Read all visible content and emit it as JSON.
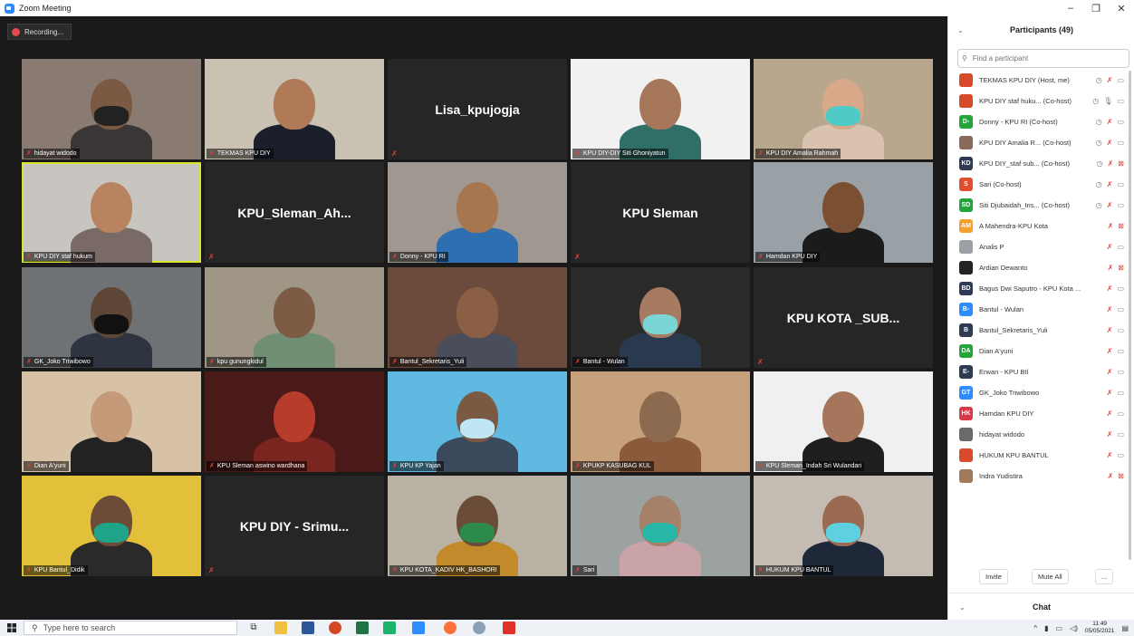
{
  "window": {
    "title": "Zoom Meeting"
  },
  "recording": {
    "label": "Recording..."
  },
  "tiles": [
    {
      "name": "hidayat widodo",
      "type": "video",
      "bg": "#8a7b72",
      "skin": "#7b5a44",
      "shirt": "#3a3636",
      "mask": "#222222"
    },
    {
      "name": "TEKMAS KPU DIY",
      "type": "video",
      "bg": "#c9c2b3",
      "skin": "#b07a58",
      "shirt": "#1b1f2b",
      "mask": ""
    },
    {
      "name": "",
      "type": "name",
      "display": "Lisa_kpujogja"
    },
    {
      "name": "KPU DIY-DIY Siti Ghoniyatun",
      "type": "video",
      "bg": "#f1f1f1",
      "skin": "#a7775b",
      "shirt": "#2f6f68",
      "mask": ""
    },
    {
      "name": "KPU DIY Amalia Rahmah",
      "type": "video",
      "bg": "#b9a78d",
      "skin": "#d8a889",
      "shirt": "#d9c3b0",
      "mask": "#4fcac6"
    },
    {
      "name": "KPU DIY staf hukum",
      "type": "video",
      "bg": "#c8c5c0",
      "skin": "#b8835f",
      "shirt": "#7a6a66",
      "mask": "",
      "active": true
    },
    {
      "name": "",
      "type": "name",
      "display": "KPU_Sleman_Ah..."
    },
    {
      "name": "Donny - KPU RI",
      "type": "video",
      "bg": "#a09890",
      "skin": "#a7764e",
      "shirt": "#2d6fb0",
      "mask": ""
    },
    {
      "name": "",
      "type": "name",
      "display": "KPU Sleman"
    },
    {
      "name": "Hamdan KPU DIY",
      "type": "video",
      "bg": "#9aa1a6",
      "skin": "#7a4f32",
      "shirt": "#1b1b1b",
      "mask": ""
    },
    {
      "name": "GK_Joko Triwibowo",
      "type": "video",
      "bg": "#6f7275",
      "skin": "#5e4636",
      "shirt": "#2f3540",
      "mask": "#111111"
    },
    {
      "name": "kpu gunungkidul",
      "type": "video",
      "bg": "#9f9686",
      "skin": "#7d5b44",
      "shirt": "#6f8e73",
      "mask": ""
    },
    {
      "name": "Bantul_Sekretaris_Yuli",
      "type": "video",
      "bg": "#6d4b3c",
      "skin": "#8b5f43",
      "shirt": "#4a4e5a",
      "mask": ""
    },
    {
      "name": "Bantul - Wulan",
      "type": "video",
      "bg": "#2a2a2a",
      "skin": "#a77b62",
      "shirt": "#2a3a4e",
      "mask": "#7ad6d5"
    },
    {
      "name": "",
      "type": "name",
      "display": "KPU KOTA _SUB..."
    },
    {
      "name": "Dian A'yuni",
      "type": "video",
      "bg": "#d8c2a6",
      "skin": "#c49a78",
      "shirt": "#222222",
      "mask": ""
    },
    {
      "name": "KPU Sleman aswino wardhana",
      "type": "video",
      "bg": "#4a1a18",
      "skin": "#b83c2c",
      "shirt": "#7a2520",
      "mask": ""
    },
    {
      "name": "KPU KP Yajan",
      "type": "video",
      "bg": "#5fb9e0",
      "skin": "#7b5a44",
      "shirt": "#3a4a5c",
      "mask": "#bfe6f3"
    },
    {
      "name": "KPUKP KASUBAG KUL",
      "type": "video",
      "bg": "#c7a17c",
      "skin": "#8b6a50",
      "shirt": "#8b5a3a",
      "mask": ""
    },
    {
      "name": "KPU Sleman_Indah Sri Wulandari",
      "type": "video",
      "bg": "#f0f0f0",
      "skin": "#a5765c",
      "shirt": "#1f1f1f",
      "mask": ""
    },
    {
      "name": "KPU Bantul_Didik",
      "type": "video",
      "bg": "#e3c03a",
      "skin": "#6c4b38",
      "shirt": "#2a2a2a",
      "mask": "#1fa48a"
    },
    {
      "name": "",
      "type": "name",
      "display": "KPU DIY - Srimu..."
    },
    {
      "name": "KPU KOTA_KADIV HK_BASHORI",
      "type": "video",
      "bg": "#b9b2a4",
      "skin": "#6b4c38",
      "shirt": "#c28a2a",
      "mask": "#2c8a4a"
    },
    {
      "name": "Sari",
      "type": "video",
      "bg": "#9ca2a0",
      "skin": "#a68068",
      "shirt": "#c9a3a8",
      "mask": "#28b6a6"
    },
    {
      "name": "HUKUM KPU BANTUL",
      "type": "video",
      "bg": "#c4bcb3",
      "skin": "#9a6a52",
      "shirt": "#1e2838",
      "mask": "#5fd0e0"
    }
  ],
  "panel": {
    "title": "Participants (49)",
    "search_placeholder": "Find a participant",
    "invite": "Invite",
    "mute_all": "Mute All",
    "more": "...",
    "chat": "Chat",
    "participants": [
      {
        "initials": "",
        "color": "#d94a2a",
        "name": "TEKMAS KPU DIY (Host, me)",
        "icons": [
          "share",
          "mic-off",
          "cam"
        ]
      },
      {
        "initials": "",
        "color": "#d94a2a",
        "name": "KPU DIY staf huku... (Co-host)",
        "icons": [
          "share",
          "mic",
          "cam"
        ]
      },
      {
        "initials": "D-",
        "color": "#22a63c",
        "name": "Donny - KPU RI (Co-host)",
        "icons": [
          "share",
          "mic-off",
          "cam"
        ]
      },
      {
        "initials": "",
        "color": "#8a6a5a",
        "name": "KPU DIY Amalia R... (Co-host)",
        "icons": [
          "share",
          "mic-off",
          "cam"
        ]
      },
      {
        "initials": "KD",
        "color": "#2e3b55",
        "name": "KPU DIY_staf sub... (Co-host)",
        "icons": [
          "share",
          "mic-off",
          "cam-off"
        ]
      },
      {
        "initials": "S",
        "color": "#e04e2f",
        "name": "Sari (Co-host)",
        "icons": [
          "share",
          "mic-off",
          "cam"
        ]
      },
      {
        "initials": "SD",
        "color": "#22a63c",
        "name": "Siti Djubaidah_Ins... (Co-host)",
        "icons": [
          "share",
          "mic-off",
          "cam"
        ]
      },
      {
        "initials": "AM",
        "color": "#f2a12e",
        "name": "A Mahendra-KPU Kota",
        "icons": [
          "mic-off",
          "cam-off"
        ]
      },
      {
        "initials": "",
        "color": "#9aa0a6",
        "name": "Analis P",
        "icons": [
          "mic-off",
          "cam"
        ]
      },
      {
        "initials": "",
        "color": "#222222",
        "name": "Ardian Dewanto",
        "icons": [
          "mic-off",
          "cam-off"
        ]
      },
      {
        "initials": "BD",
        "color": "#2e3b55",
        "name": "Bagus Dwi Saputro - KPU Kota ...",
        "icons": [
          "mic-off",
          "cam"
        ]
      },
      {
        "initials": "B-",
        "color": "#2d8cff",
        "name": "Bantul - Wulan",
        "icons": [
          "mic-off",
          "cam"
        ]
      },
      {
        "initials": "B",
        "color": "#2e3b55",
        "name": "Bantul_Sekretaris_Yuli",
        "icons": [
          "mic-off",
          "cam"
        ]
      },
      {
        "initials": "DA",
        "color": "#22a63c",
        "name": "Dian A'yuni",
        "icons": [
          "mic-off",
          "cam"
        ]
      },
      {
        "initials": "E-",
        "color": "#2e3b55",
        "name": "Erwan - KPU Btl",
        "icons": [
          "mic-off",
          "cam"
        ]
      },
      {
        "initials": "GT",
        "color": "#2d8cff",
        "name": "GK_Joko Triwibowo",
        "icons": [
          "mic-off",
          "cam"
        ]
      },
      {
        "initials": "HK",
        "color": "#d93a4a",
        "name": "Hamdan KPU DIY",
        "icons": [
          "mic-off",
          "cam"
        ]
      },
      {
        "initials": "",
        "color": "#6a6a6a",
        "name": "hidayat widodo",
        "icons": [
          "mic-off",
          "cam"
        ]
      },
      {
        "initials": "",
        "color": "#d94a2a",
        "name": "HUKUM KPU BANTUL",
        "icons": [
          "mic-off",
          "cam"
        ]
      },
      {
        "initials": "",
        "color": "#a07a5a",
        "name": "Indra Yudistira",
        "icons": [
          "mic-off",
          "cam-off"
        ]
      }
    ]
  },
  "taskbar": {
    "search_placeholder": "Type here to search",
    "time": "11:49",
    "date": "05/05/2021"
  }
}
